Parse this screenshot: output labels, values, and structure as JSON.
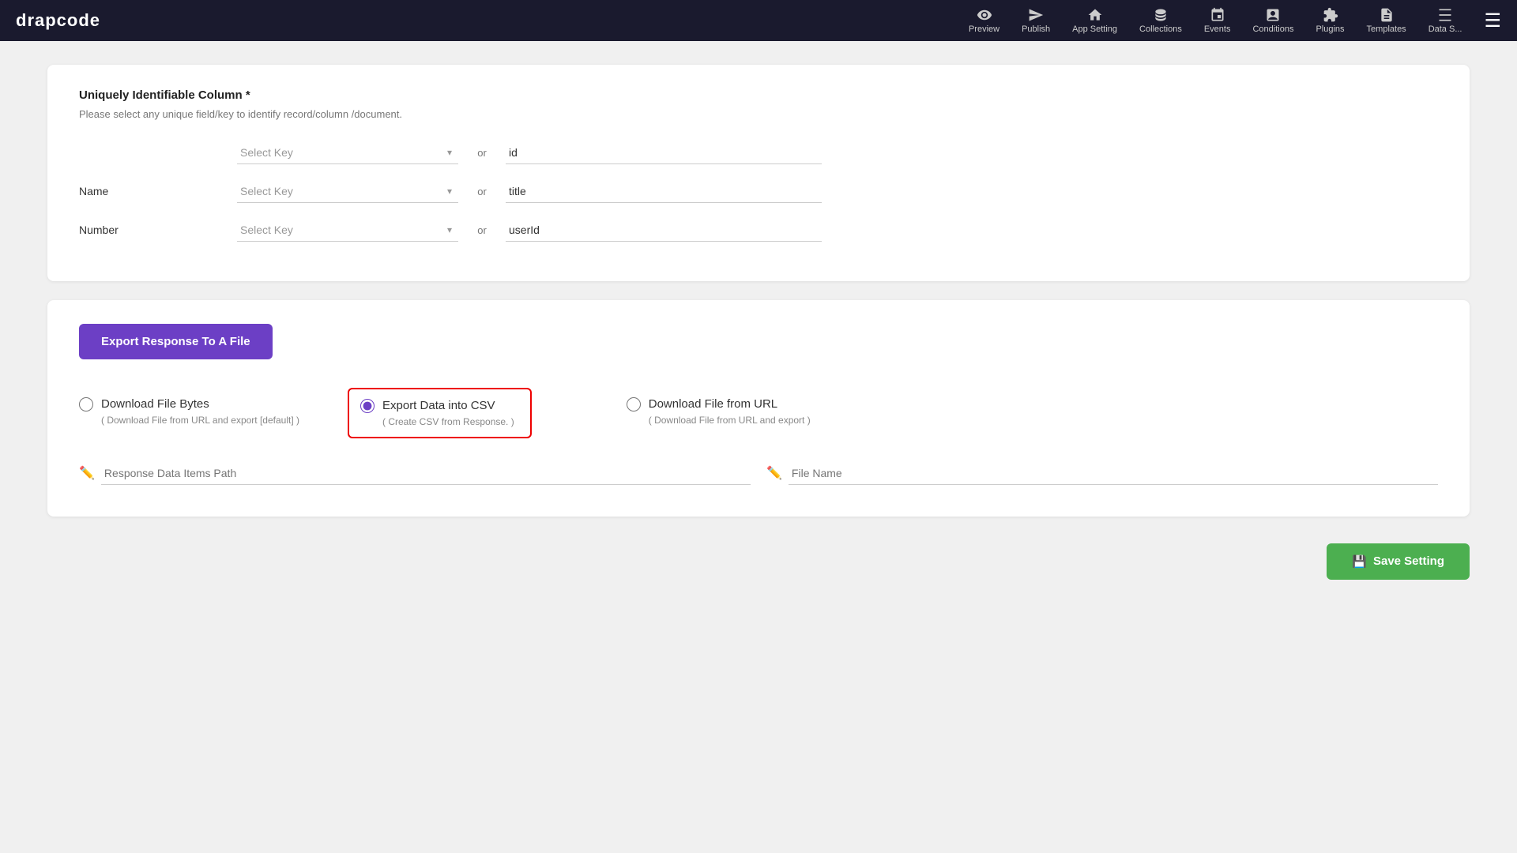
{
  "topnav": {
    "logo": "drapcode",
    "items": [
      {
        "label": "Preview",
        "icon": "eye"
      },
      {
        "label": "Publish",
        "icon": "send"
      },
      {
        "label": "App Setting",
        "icon": "home"
      },
      {
        "label": "Collections",
        "icon": "database"
      },
      {
        "label": "Events",
        "icon": "events"
      },
      {
        "label": "Conditions",
        "icon": "conditions"
      },
      {
        "label": "Plugins",
        "icon": "plugins"
      },
      {
        "label": "Templates",
        "icon": "templates"
      },
      {
        "label": "Data S...",
        "icon": "data"
      }
    ]
  },
  "uniquely_identifiable": {
    "title": "Uniquely Identifiable Column *",
    "subtitle": "Please select any unique field/key to identify record/column /document.",
    "fields": [
      {
        "label": "",
        "select_placeholder": "Select Key",
        "or": "or",
        "value": "id"
      },
      {
        "label": "Name",
        "select_placeholder": "Select Key",
        "or": "or",
        "value": "title"
      },
      {
        "label": "Number",
        "select_placeholder": "Select Key",
        "or": "or",
        "value": "userId"
      }
    ]
  },
  "export_section": {
    "button_label": "Export Response To A File",
    "options": [
      {
        "id": "download-file-bytes",
        "label": "Download File Bytes",
        "sub": "( Download File from URL and export [default] )",
        "selected": false
      },
      {
        "id": "export-data-csv",
        "label": "Export Data into CSV",
        "sub": "( Create CSV from Response. )",
        "selected": true
      },
      {
        "id": "download-file-url",
        "label": "Download File from URL",
        "sub": "( Download File from URL and export )",
        "selected": false
      }
    ],
    "response_path_placeholder": "Response Data Items Path",
    "file_name_placeholder": "File Name"
  },
  "footer": {
    "save_button": "Save Setting",
    "save_icon": "💾"
  }
}
